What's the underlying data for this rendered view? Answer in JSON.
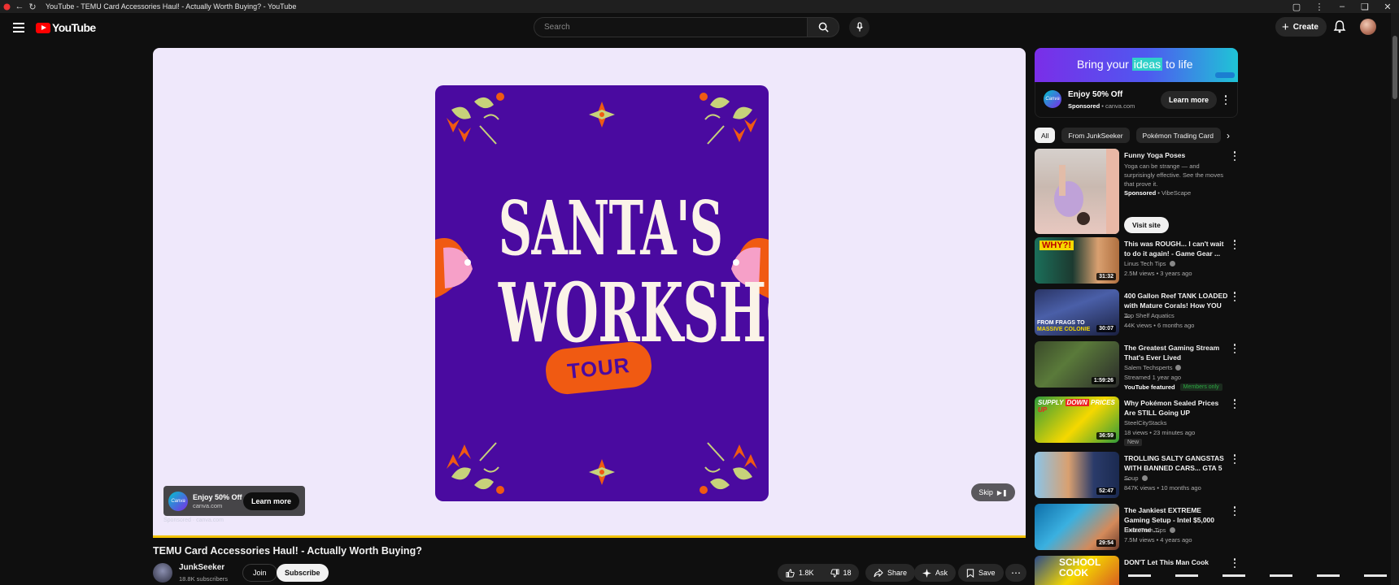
{
  "window": {
    "title": "YouTube - TEMU Card Accessories Haul! - Actually Worth Buying? - YouTube"
  },
  "masthead": {
    "logo_text": "YouTube",
    "search_placeholder": "Search",
    "create_label": "Create"
  },
  "player": {
    "poster": {
      "line1": "SANTA'S",
      "line2": "WORKSHOP",
      "pill": "TOUR",
      "colors": {
        "background": "#4a0aa0",
        "pill": "#f05a12",
        "text": "#fbf3e8"
      }
    },
    "ad_card": {
      "brand_icon": "Canva",
      "headline": "Enjoy 50% Off",
      "domain": "canva.com",
      "cta": "Learn more"
    },
    "ad_meta": "Sponsored · canva.com",
    "skip_label": "Skip",
    "progress_fraction": 1.0,
    "progress_color": "#f2c200"
  },
  "video": {
    "title": "TEMU Card Accessories Haul! - Actually Worth Buying?",
    "channel": "JunkSeeker",
    "subscribers": "18.8K subscribers",
    "join_label": "Join",
    "subscribe_label": "Subscribe",
    "likes": "1.8K",
    "dislikes": "18",
    "share_label": "Share",
    "ask_label": "Ask",
    "save_label": "Save"
  },
  "sidebar": {
    "ad": {
      "banner_text_pre": "Bring your",
      "banner_text_highlight": "ideas",
      "banner_text_post": "to life",
      "brand_icon": "Canva",
      "headline": "Enjoy 50% Off",
      "sponsored": "Sponsored",
      "domain": "canva.com",
      "cta": "Learn more"
    },
    "chips": [
      "All",
      "From JunkSeeker",
      "Pokémon Trading Card"
    ],
    "recommendations": [
      {
        "title": "Funny Yoga Poses",
        "description": "Yoga can be strange — and surprisingly effective. See the moves that prove it.",
        "sponsored": "Sponsored",
        "advertiser": "VibeScape",
        "cta": "Visit site"
      },
      {
        "title": "This was ROUGH... I can't wait to do it again! - Game Gear ...",
        "channel": "Linus Tech Tips",
        "meta": "2.5M views • 3 years ago",
        "duration": "31:32"
      },
      {
        "title": "400 Gallon Reef TANK LOADED with Mature Corals! How YOU ...",
        "channel": "Top Shelf Aquatics",
        "meta": "44K views • 6 months ago",
        "duration": "30:07"
      },
      {
        "title": "The Greatest Gaming Stream That's Ever Lived",
        "channel": "Salem Techsperts",
        "meta": "Streamed 1 year ago",
        "featured": "YouTube featured",
        "members": "Members only",
        "duration": "1:59:26"
      },
      {
        "title": "Why Pokémon Sealed Prices Are STILL Going UP",
        "channel": "SteelCityStacks",
        "meta": "18 views • 23 minutes ago",
        "badge": "New",
        "duration": "36:59"
      },
      {
        "title": "TROLLING SALTY GANGSTAS WITH BANNED CARS... GTA 5 ...",
        "channel": "Soup",
        "meta": "847K views • 10 months ago",
        "duration": "52:47"
      },
      {
        "title": "The Jankiest EXTREME Gaming Setup - Intel $5,000 Extreme ...",
        "channel": "Linus Tech Tips",
        "meta": "7.5M views • 4 years ago",
        "duration": "29:54"
      },
      {
        "title": "DON'T Let This Man Cook",
        "channel": "",
        "meta": "",
        "duration": ""
      }
    ]
  }
}
